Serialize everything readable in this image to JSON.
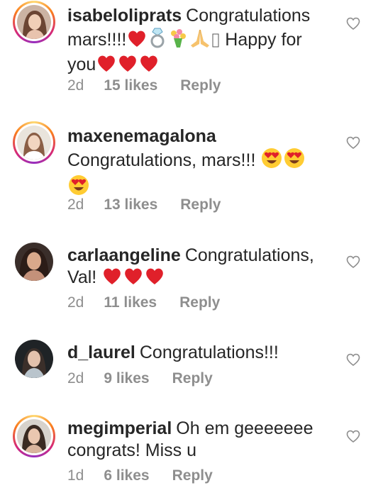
{
  "comments": [
    {
      "username": "isabeloliprats",
      "text_before": "Congratulations mars!!!!",
      "text_after": " Happy for you",
      "time": "2d",
      "likes": "15 likes",
      "reply": "Reply",
      "emoji_names": [
        "red-heart",
        "ring",
        "bouquet",
        "praying-hands",
        "missing-glyph"
      ],
      "trailing_emoji": [
        "red-heart",
        "red-heart",
        "red-heart"
      ]
    },
    {
      "username": "maxenemagalona",
      "text": "Congratulations, mars!!!",
      "time": "2d",
      "likes": "13 likes",
      "reply": "Reply",
      "emoji_names": [
        "heart-eyes",
        "heart-eyes",
        "heart-eyes"
      ]
    },
    {
      "username": "carlaangeline",
      "text": "Congratulations, Val!",
      "time": "2d",
      "likes": "11 likes",
      "reply": "Reply",
      "emoji_names": [
        "red-heart",
        "red-heart",
        "red-heart"
      ]
    },
    {
      "username": "d_laurel",
      "text": "Congratulations!!!",
      "time": "2d",
      "likes": "9 likes",
      "reply": "Reply"
    },
    {
      "username": "megimperial",
      "text": "Oh em geeeeeee congrats! Miss u",
      "time": "1d",
      "likes": "6 likes",
      "reply": "Reply"
    }
  ],
  "colors": {
    "text": "#262626",
    "meta": "#8e8e8e",
    "heart_emoji": "#e0202a",
    "story_ring": [
      "#feda75",
      "#fa7e1e",
      "#d62976",
      "#962fbf"
    ]
  },
  "icons": {
    "like_button": "heart-outline-icon"
  }
}
